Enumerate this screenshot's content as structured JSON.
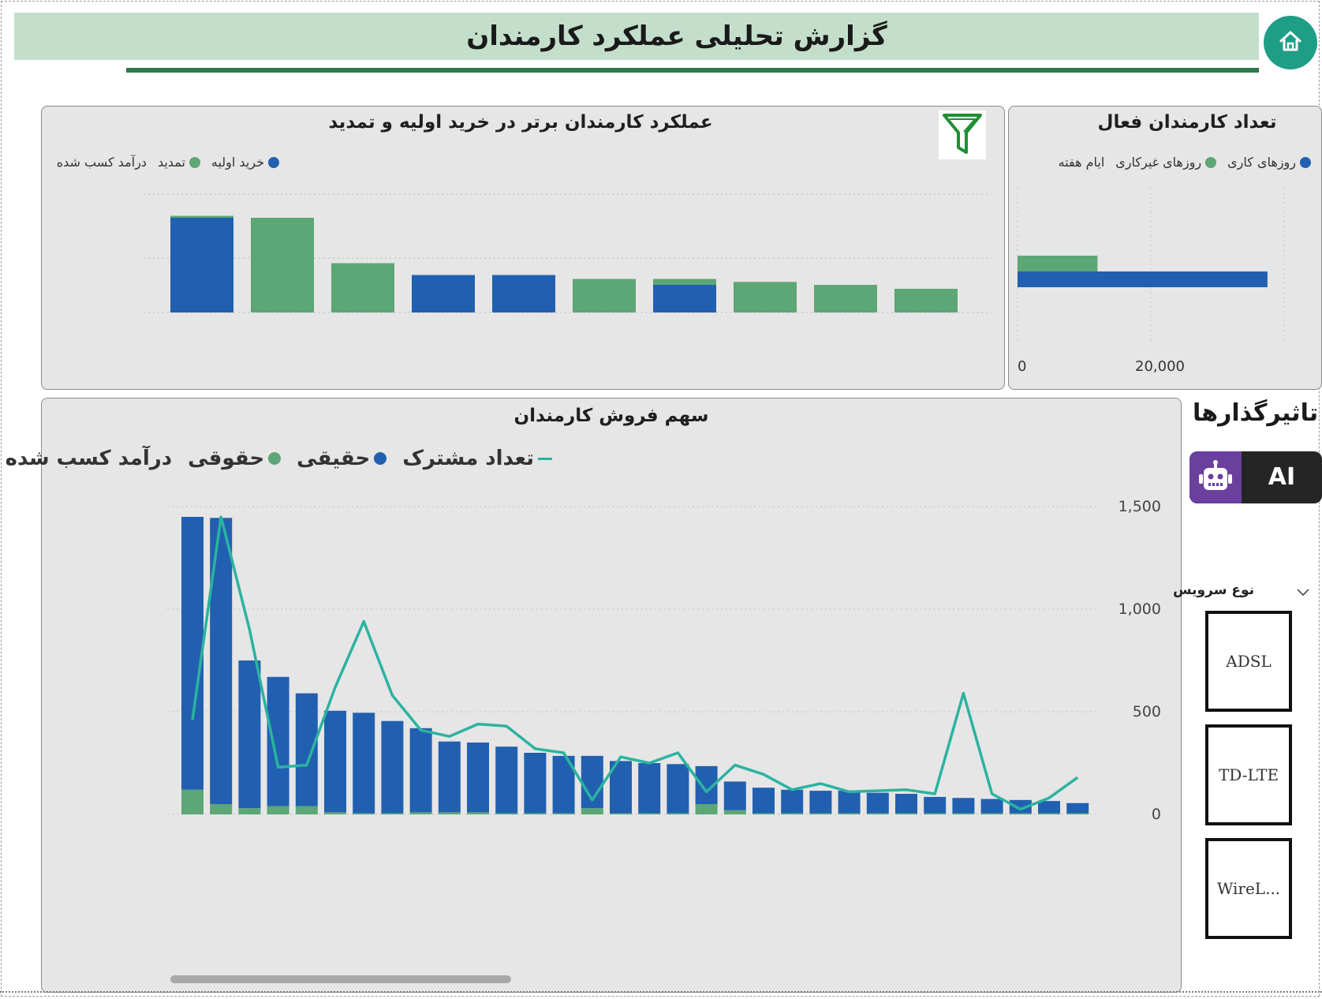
{
  "header": {
    "title": "گزارش تحلیلی عملکرد کارمندان"
  },
  "colors": {
    "blue": "#2160b0",
    "green": "#5da675",
    "teal": "#2bb3a0",
    "header_bg": "#c3dfcb",
    "header_line": "#2f7a4a"
  },
  "icons": {
    "home": "home-icon",
    "filter": "filter-icon",
    "robot": "robot-icon",
    "chevron": "chevron-down-icon"
  },
  "top_chart": {
    "title": "عملکرد کارمندان برتر در خرید اولیه و تمدید",
    "legend": [
      {
        "label": "خرید اولیه",
        "color": "#2160b0"
      },
      {
        "label": "تمدید",
        "color": "#5da675"
      },
      {
        "label": "درآمد کسب شده",
        "color": ""
      }
    ]
  },
  "active_chart": {
    "title": "تعداد کارمندان فعال",
    "legend": [
      {
        "label": "روزهای کاری",
        "color": "#2160b0"
      },
      {
        "label": "روزهای غیرکاری",
        "color": "#5da675"
      },
      {
        "label": "ایام هفته",
        "color": ""
      }
    ]
  },
  "share_chart": {
    "title": "سهم فروش کارمندان",
    "legend": [
      {
        "label": "تعداد مشترک",
        "color": "#2bb3a0",
        "kind": "line"
      },
      {
        "label": "حقیقی",
        "color": "#2160b0",
        "kind": "dot"
      },
      {
        "label": "حقوقی",
        "color": "#5da675",
        "kind": "dot"
      },
      {
        "label": "درآمد کسب شده",
        "color": "",
        "kind": "text"
      }
    ]
  },
  "influencers": {
    "title": "تاثیرگذارها",
    "ai_label": "AI"
  },
  "slicer": {
    "title": "نوع سرویس",
    "options": [
      "ADSL",
      "TD-LTE",
      "WireL..."
    ]
  },
  "chart_data": [
    {
      "type": "bar",
      "name": "top-performers",
      "stacked": true,
      "categories": [
        "",
        "",
        "",
        "",
        "",
        "",
        "",
        "",
        "",
        ""
      ],
      "series": [
        {
          "name": "خرید اولیه",
          "color": "#2160b0",
          "values": [
            96,
            0,
            0,
            38,
            38,
            0,
            28,
            0,
            0,
            0
          ]
        },
        {
          "name": "تمدید",
          "color": "#5da675",
          "values": [
            2,
            96,
            50,
            0,
            0,
            34,
            6,
            31,
            28,
            24
          ]
        }
      ],
      "ylim": [
        0,
        120
      ],
      "grid": true
    },
    {
      "type": "bar",
      "orientation": "horizontal",
      "name": "active-employees",
      "series": [
        {
          "name": "روزهای کاری",
          "color": "#2160b0",
          "values": [
            37500
          ]
        },
        {
          "name": "روزهای غیرکاری",
          "color": "#5da675",
          "values": [
            12000
          ]
        }
      ],
      "xticks": [
        "0",
        "20,000"
      ],
      "xlim": [
        0,
        40000
      ]
    },
    {
      "type": "bar",
      "name": "employee-sales-share",
      "stacked": true,
      "categories": [
        "",
        "",
        "",
        "",
        "",
        "",
        "",
        "",
        "",
        "",
        "",
        "",
        "",
        "",
        "",
        "",
        "",
        "",
        "",
        "",
        "",
        "",
        "",
        "",
        "",
        "",
        "",
        "",
        "",
        "",
        "",
        ""
      ],
      "series": [
        {
          "name": "حقیقی",
          "color": "#2160b0",
          "values": [
            1330,
            1395,
            720,
            630,
            550,
            495,
            490,
            450,
            410,
            345,
            340,
            325,
            295,
            280,
            255,
            255,
            245,
            240,
            185,
            140,
            125,
            115,
            110,
            110,
            100,
            95,
            80,
            75,
            70,
            65,
            60,
            50
          ]
        },
        {
          "name": "حقوقی",
          "color": "#5da675",
          "values": [
            120,
            50,
            30,
            40,
            40,
            10,
            5,
            5,
            10,
            10,
            10,
            5,
            5,
            5,
            30,
            5,
            5,
            5,
            50,
            20,
            5,
            5,
            5,
            5,
            5,
            5,
            5,
            5,
            5,
            5,
            5,
            5
          ]
        },
        {
          "name": "تعداد مشترک",
          "color": "#2bb3a0",
          "kind": "line",
          "values": [
            460,
            1450,
            900,
            230,
            240,
            620,
            940,
            580,
            410,
            380,
            440,
            430,
            320,
            300,
            70,
            280,
            250,
            300,
            110,
            240,
            195,
            120,
            150,
            110,
            115,
            120,
            100,
            590,
            100,
            25,
            80,
            180
          ]
        }
      ],
      "yticks": [
        "1,500",
        "1,000",
        "500",
        "0"
      ],
      "ylim": [
        0,
        1500
      ],
      "grid": true
    }
  ]
}
